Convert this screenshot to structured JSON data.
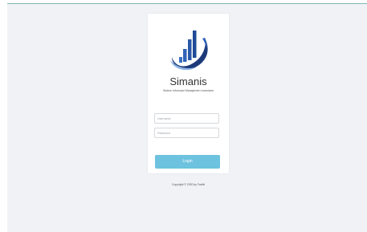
{
  "app": {
    "name": "Simanis",
    "tagline": "Sistem Informasi Manajemen Inventaris"
  },
  "login": {
    "username_placeholder": "Username",
    "password_placeholder": "Password",
    "button_label": "Login"
  },
  "footer": {
    "copyright": "Copyright © 2020 by Fadhil"
  },
  "colors": {
    "page_background": "#f1f2f6",
    "card": "#ffffff",
    "button": "#6cc2df",
    "logo_dark": "#1c3a7a",
    "logo_mid": "#2f63b8",
    "logo_light": "#8fb4e3"
  },
  "icons": {
    "logo": "bar-chart-swoosh-logo"
  }
}
